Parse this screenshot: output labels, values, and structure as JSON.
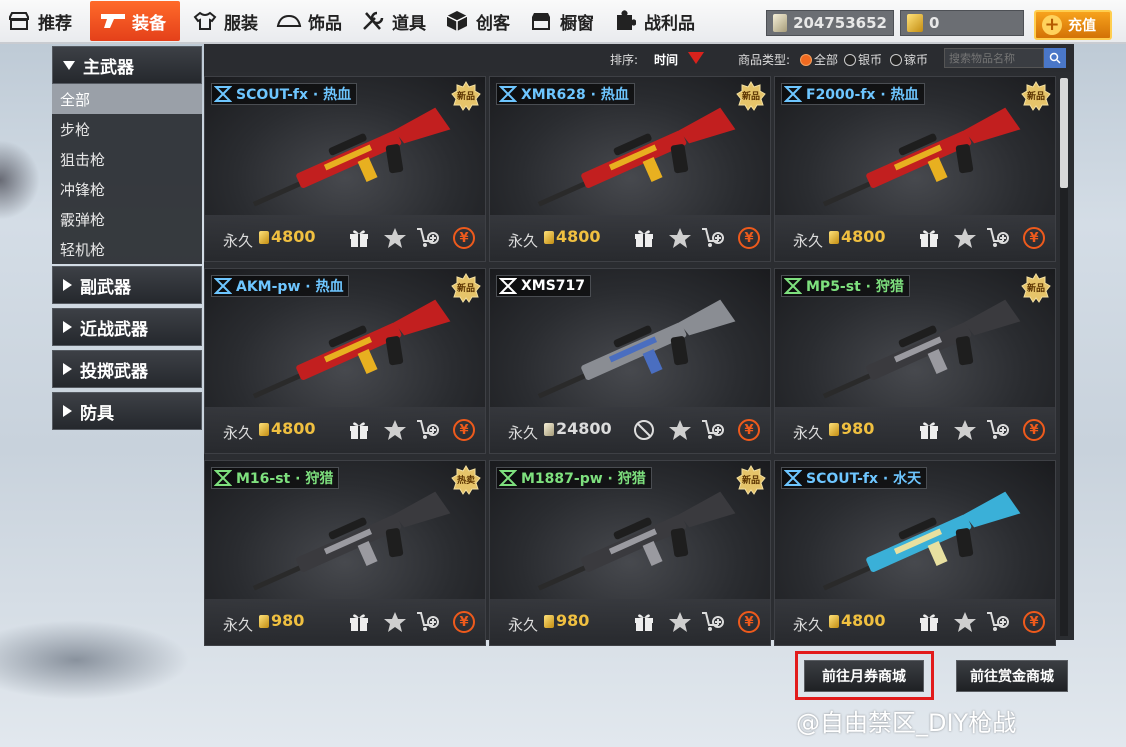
{
  "nav": {
    "tabs": [
      {
        "label": "推荐",
        "icon": "store-icon"
      },
      {
        "label": "装备",
        "icon": "gun-icon",
        "active": true
      },
      {
        "label": "服装",
        "icon": "shirt-icon"
      },
      {
        "label": "饰品",
        "icon": "hat-icon"
      },
      {
        "label": "道具",
        "icon": "tools-icon"
      },
      {
        "label": "创客",
        "icon": "cube-icon"
      },
      {
        "label": "橱窗",
        "icon": "shop-icon"
      },
      {
        "label": "战利品",
        "icon": "puzzle-icon"
      }
    ],
    "silver_balance": "204753652",
    "gold_balance": "0",
    "recharge_label": "充值"
  },
  "sidebar": {
    "primary": {
      "label": "主武器",
      "expanded": true
    },
    "subitems": [
      {
        "label": "全部",
        "active": true
      },
      {
        "label": "步枪"
      },
      {
        "label": "狙击枪"
      },
      {
        "label": "冲锋枪"
      },
      {
        "label": "霰弹枪"
      },
      {
        "label": "轻机枪"
      }
    ],
    "categories": [
      {
        "label": "副武器"
      },
      {
        "label": "近战武器"
      },
      {
        "label": "投掷武器"
      },
      {
        "label": "防具"
      }
    ]
  },
  "filter": {
    "sort_label": "排序:",
    "sort_value": "时间",
    "type_label": "商品类型:",
    "options": [
      "全部",
      "银币",
      "镓币"
    ],
    "selected": "全部",
    "search_placeholder": "搜索物品名称"
  },
  "items": [
    {
      "name": "SCOUT-fx · 热血",
      "name_color": "#6ec6ff",
      "badge": "新品",
      "duration": "永久",
      "currency": "gold",
      "price": "4800",
      "gun_colors": [
        "#c21f1f",
        "#e8b020"
      ],
      "gift": true
    },
    {
      "name": "XMR628 · 热血",
      "name_color": "#6ec6ff",
      "badge": "新品",
      "duration": "永久",
      "currency": "gold",
      "price": "4800",
      "gun_colors": [
        "#c21f1f",
        "#e8b020"
      ],
      "gift": true
    },
    {
      "name": "F2000-fx · 热血",
      "name_color": "#6ec6ff",
      "badge": "新品",
      "duration": "永久",
      "currency": "gold",
      "price": "4800",
      "gun_colors": [
        "#c21f1f",
        "#e8b020"
      ],
      "gift": true
    },
    {
      "name": "AKM-pw · 热血",
      "name_color": "#6ec6ff",
      "badge": "新品",
      "duration": "永久",
      "currency": "gold",
      "price": "4800",
      "gun_colors": [
        "#c21f1f",
        "#e8b020"
      ],
      "gift": true
    },
    {
      "name": "XMS717",
      "name_color": "#ffffff",
      "badge": "",
      "duration": "永久",
      "currency": "silver",
      "price": "24800",
      "gun_colors": [
        "#8a8d93",
        "#4a6ec0"
      ],
      "gift": false
    },
    {
      "name": "MP5-st · 狩猎",
      "name_color": "#7ee07e",
      "badge": "新品",
      "duration": "永久",
      "currency": "gold",
      "price": "980",
      "gun_colors": [
        "#3a3a3e",
        "#9a9aa0"
      ],
      "gift": true
    },
    {
      "name": "M16-st · 狩猎",
      "name_color": "#7ee07e",
      "badge": "热卖",
      "duration": "永久",
      "currency": "gold",
      "price": "980",
      "gun_colors": [
        "#3a3a3e",
        "#9a9aa0"
      ],
      "gift": true
    },
    {
      "name": "M1887-pw · 狩猎",
      "name_color": "#7ee07e",
      "badge": "新品",
      "duration": "永久",
      "currency": "gold",
      "price": "980",
      "gun_colors": [
        "#3a3a3e",
        "#9a9aa0"
      ],
      "gift": true
    },
    {
      "name": "SCOUT-fx · 水天",
      "name_color": "#6ec6ff",
      "badge": "",
      "duration": "永久",
      "currency": "gold",
      "price": "4800",
      "gun_colors": [
        "#3ab0d8",
        "#e8e0a0"
      ],
      "gift": true
    }
  ],
  "bottom": {
    "monthly_store_label": "前往月券商城",
    "bounty_store_label": "前往赏金商城"
  },
  "watermark": "@自由禁区_DIY枪战",
  "colors": {
    "accent": "#e4401a",
    "highlight_frame": "#e21b1b",
    "gold_price": "#f0c040"
  }
}
